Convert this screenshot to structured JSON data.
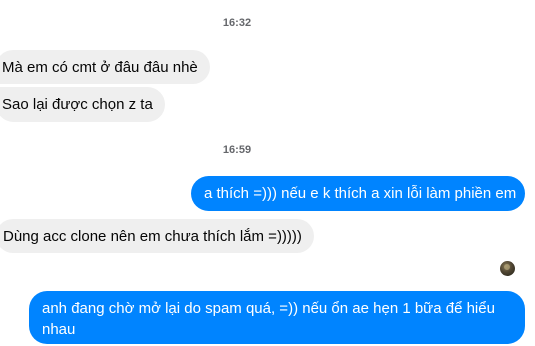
{
  "conversation": {
    "timestamps": [
      "16:32",
      "16:59"
    ],
    "messages": [
      {
        "direction": "incoming",
        "text": "Mà em có cmt ở đâu đâu nhè"
      },
      {
        "direction": "incoming",
        "text": "Sao lại được chọn z ta"
      },
      {
        "direction": "outgoing",
        "text": "a thích =))) nếu e k thích a xin lỗi làm phiền em"
      },
      {
        "direction": "incoming",
        "text": "Dùng acc clone nên em chưa thích lắm =)))))"
      },
      {
        "direction": "outgoing",
        "text": "anh đang chờ mở lại do spam quá, =)) nếu ổn ae hẹn 1 bữa để hiểu nhau"
      }
    ]
  },
  "colors": {
    "outgoing_bubble": "#0084ff",
    "incoming_bubble": "#efefef",
    "timestamp_text": "#65676b"
  },
  "icons": {
    "seen_indicator": "seen-avatar-icon"
  }
}
